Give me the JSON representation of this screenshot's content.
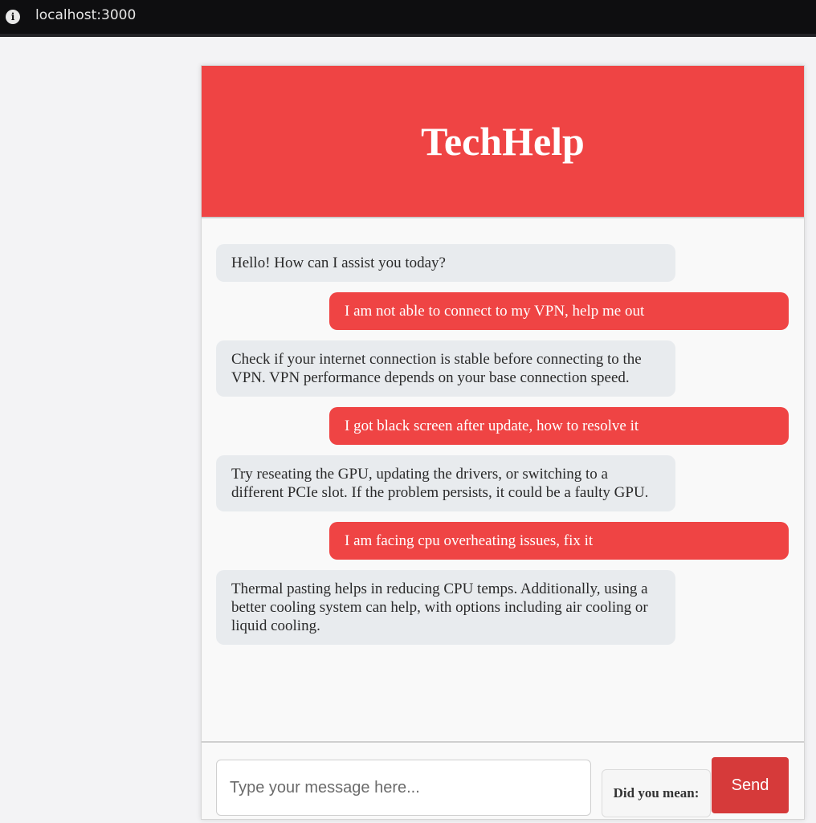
{
  "browser": {
    "url": "localhost:3000",
    "info_icon_glyph": "i"
  },
  "header": {
    "title": "TechHelp",
    "accent_color": "#ef4444"
  },
  "messages": [
    {
      "role": "bot",
      "text": "Hello! How can I assist you today?"
    },
    {
      "role": "user",
      "text": "I am not able to connect to my VPN, help me out"
    },
    {
      "role": "bot",
      "text": "Check if your internet connection is stable before connecting to the VPN. VPN performance depends on your base connection speed."
    },
    {
      "role": "user",
      "text": "I got black screen after update, how to resolve it"
    },
    {
      "role": "bot",
      "text": "Try reseating the GPU, updating the drivers, or switching to a different PCIe slot. If the problem persists, it could be a faulty GPU."
    },
    {
      "role": "user",
      "text": "I am facing cpu overheating issues, fix it"
    },
    {
      "role": "bot",
      "text": "Thermal pasting helps in reducing CPU temps. Additionally, using a better cooling system can help, with options including air cooling or liquid cooling."
    }
  ],
  "composer": {
    "placeholder": "Type your message here...",
    "value": "",
    "suggestion_label": "Did you mean:",
    "send_label": "Send"
  }
}
